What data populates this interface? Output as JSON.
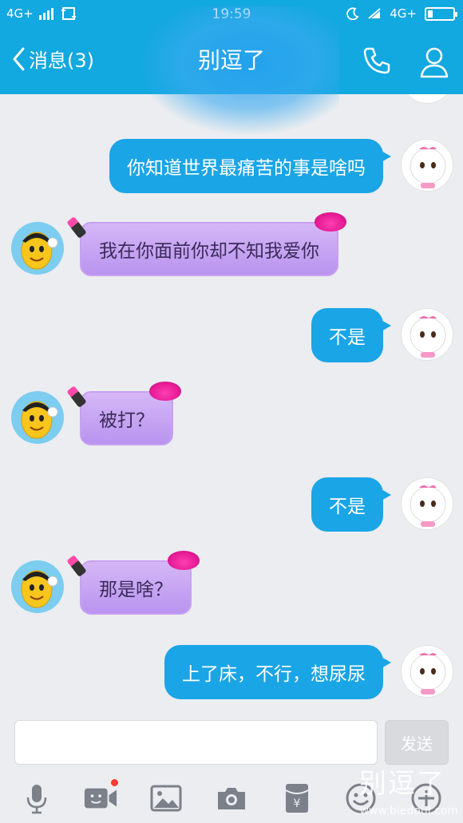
{
  "status_bar": {
    "network_left": "4G+",
    "time": "19:59",
    "network_right": "4G+"
  },
  "header": {
    "back_label": "消息(3)",
    "title": "别逗了"
  },
  "messages": [
    {
      "side": "right",
      "text": "你知道世界最痛苦的事是啥吗"
    },
    {
      "side": "left",
      "text": "我在你面前你却不知我爱你"
    },
    {
      "side": "right",
      "text": "不是"
    },
    {
      "side": "left",
      "text": "被打？"
    },
    {
      "side": "right",
      "text": "不是"
    },
    {
      "side": "left",
      "text": "那是啥？"
    },
    {
      "side": "right",
      "text": "上了床，不行，想尿尿"
    }
  ],
  "input": {
    "value": "",
    "placeholder": "",
    "send_label": "发送"
  },
  "toolbar": {
    "icons": [
      "microphone-icon",
      "video-icon",
      "image-icon",
      "camera-icon",
      "red-packet-icon",
      "emoji-icon",
      "plus-icon"
    ]
  },
  "watermark": {
    "text": "别逗了",
    "url": "www.biedoul.com"
  },
  "colors": {
    "accent": "#12a8e0",
    "bubble_right": "#1aa5e6",
    "bubble_left": "#c4a2f2",
    "notification_dot": "#ff3b30"
  }
}
